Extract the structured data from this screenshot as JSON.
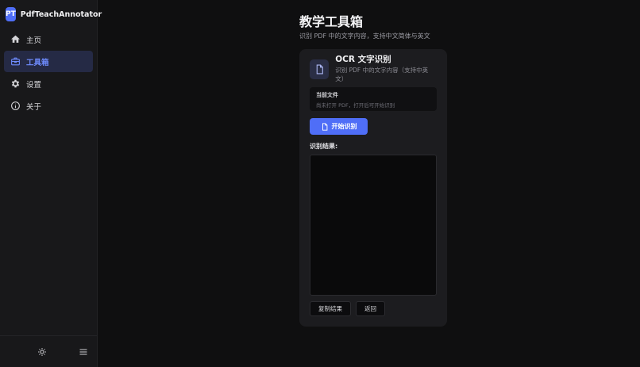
{
  "brand": {
    "logo": "PT",
    "name": "PdfTeachAnnotator"
  },
  "sidebar": {
    "items": [
      {
        "label": "主页",
        "icon": "home-icon",
        "active": false
      },
      {
        "label": "工具箱",
        "icon": "toolbox-icon",
        "active": true
      },
      {
        "label": "设置",
        "icon": "gear-icon",
        "active": false
      },
      {
        "label": "关于",
        "icon": "info-icon",
        "active": false
      }
    ],
    "footer": {
      "theme_icon": "sun-icon",
      "menu_icon": "menu-icon"
    }
  },
  "page": {
    "title": "教学工具箱",
    "subtitle": "识别 PDF 中的文字内容，支持中文简体与英文"
  },
  "card": {
    "icon": "document-icon",
    "title": "OCR 文字识别",
    "description": "识别 PDF 中的文字内容（支持中英文）",
    "file": {
      "label": "当前文件",
      "hint": "尚未打开 PDF，打开后可开始识别"
    },
    "start_label": "开始识别",
    "result_label": "识别结果:",
    "result_value": "",
    "copy_label": "复制结果",
    "back_label": "返回"
  },
  "colors": {
    "accent": "#4f6ef7",
    "sidebar_bg": "#18181a",
    "main_bg": "#0f0f10",
    "card_bg": "#1c1c1f"
  }
}
